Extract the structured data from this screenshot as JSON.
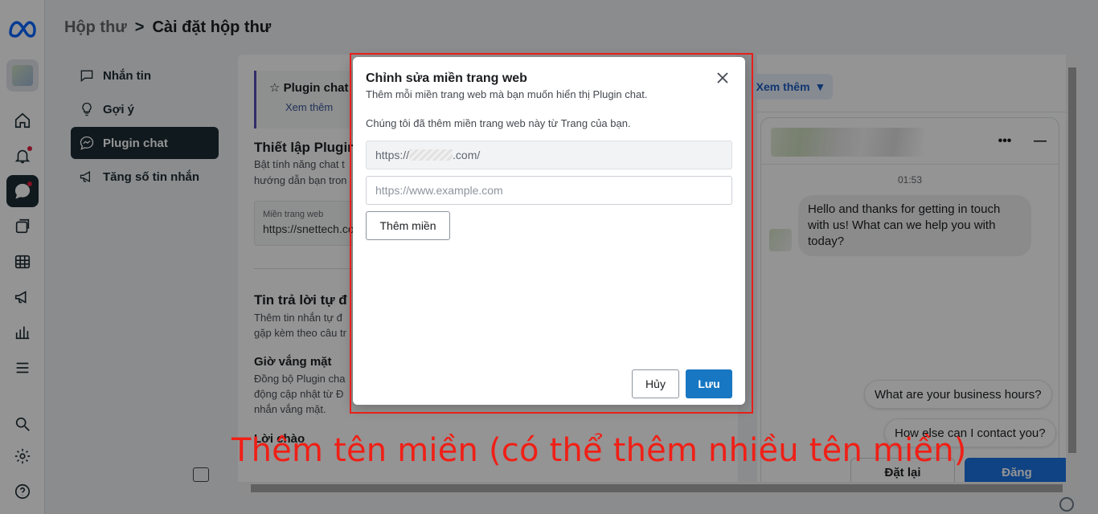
{
  "header": {
    "breadcrumb_parent": "Hộp thư",
    "breadcrumb_sep": ">",
    "breadcrumb_current": "Cài đặt hộp thư"
  },
  "sidenav": {
    "items": [
      {
        "label": "Nhắn tin",
        "icon": "chat-bubble-icon"
      },
      {
        "label": "Gợi ý",
        "icon": "lightbulb-icon"
      },
      {
        "label": "Plugin chat",
        "icon": "messenger-icon",
        "active": true
      },
      {
        "label": "Tăng số tin nhắn",
        "icon": "megaphone-icon"
      }
    ]
  },
  "main": {
    "tip_title": "Plugin chat",
    "tip_link": "Xem thêm",
    "setup_title": "Thiết lập Plugin",
    "setup_desc_1": "Bật tính năng chat t",
    "setup_desc_2": "hướng dẫn bạn tron",
    "domain_label": "Miền trang web",
    "domain_value": "https://snettech.co",
    "auto_title": "Tin trả lời tự đ",
    "auto_desc_1": "Thêm tin nhắn tự đ",
    "auto_desc_2": "gặp kèm theo câu tr",
    "away_title": "Giờ vắng mặt",
    "away_desc_1": "Đồng bộ Plugin cha",
    "away_desc_2": "động cập nhật từ Đ",
    "away_desc_3": "nhắn vắng mặt.",
    "greet_title": "Lời chào"
  },
  "preview": {
    "see_more": "Xem thêm",
    "time": "01:53",
    "greeting": "Hello and thanks for getting in touch with us! What can we help you with today?",
    "quick_replies": [
      "What are your business hours?",
      "How else can I contact you?"
    ],
    "more_btn": "•••",
    "minimize_btn": "—"
  },
  "footer": {
    "reset_label": "Đặt lại",
    "post_label": "Đăng"
  },
  "modal": {
    "title": "Chỉnh sửa miền trang web",
    "subtitle": "Thêm mỗi miền trang web mà bạn muốn hiển thị Plugin chat.",
    "info": "Chúng tôi đã thêm miền trang web này từ Trang của bạn.",
    "existing_prefix": "https://",
    "existing_suffix": ".com/",
    "new_placeholder": "https://www.example.com",
    "add_label": "Thêm miền",
    "cancel_label": "Hủy",
    "save_label": "Lưu"
  },
  "annotation": {
    "text": "Thêm tên miền (có thể thêm nhiều tên miền)",
    "color": "#f01f16"
  },
  "colors": {
    "accent": "#1877c2",
    "nav_active": "#1c2b33",
    "highlight": "#e8201b"
  }
}
